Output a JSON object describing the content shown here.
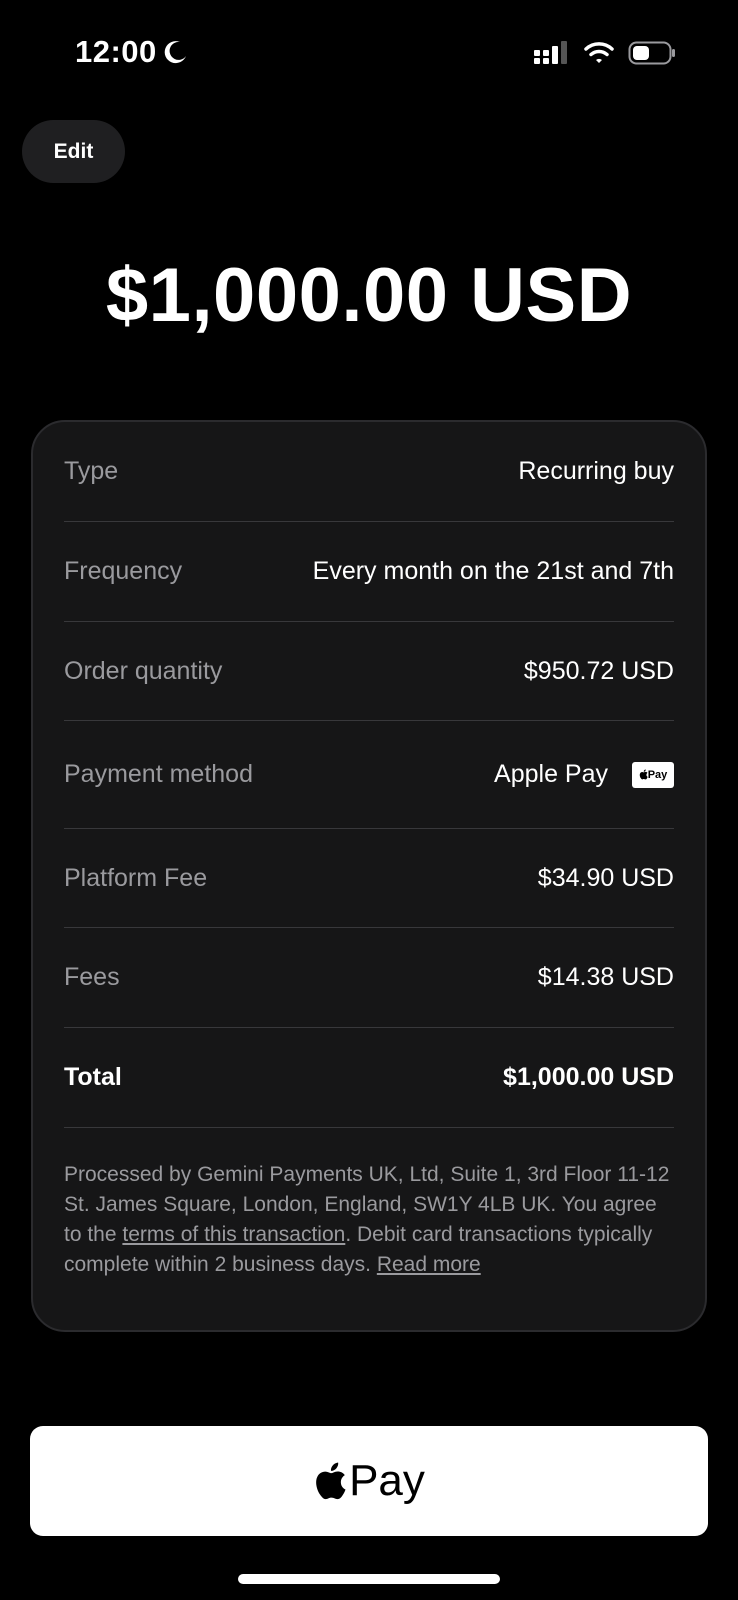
{
  "status_bar": {
    "time": "12:00",
    "icons": [
      "moon-icon",
      "cellular-signal-icon",
      "wifi-icon",
      "battery-icon"
    ]
  },
  "header": {
    "edit_label": "Edit"
  },
  "amount": "$1,000.00 USD",
  "summary": {
    "rows": [
      {
        "label": "Type",
        "value": "Recurring buy"
      },
      {
        "label": "Frequency",
        "value": "Every month on the 21st and 7th"
      },
      {
        "label": "Order quantity",
        "value": "$950.72 USD"
      },
      {
        "label": "Payment method",
        "value": "Apple Pay",
        "badge": "Pay"
      },
      {
        "label": "Platform Fee",
        "value": "$34.90 USD"
      },
      {
        "label": "Fees",
        "value": "$14.38 USD"
      },
      {
        "label": "Total",
        "value": "$1,000.00 USD"
      }
    ],
    "disclaimer": {
      "text_1": "Processed by Gemini Payments UK, Ltd, Suite 1, 3rd Floor 11-12 St. James Square, London, England, SW1Y 4LB UK. You agree to the ",
      "terms_link": "terms of this transaction",
      "text_2": ". Debit card transactions typically complete within 2 business days. ",
      "read_more": "Read more"
    }
  },
  "apple_pay_button": {
    "label": "Pay"
  },
  "colors": {
    "background": "#000000",
    "card": "#161617",
    "muted_text": "#9a9a9e",
    "button_bg": "#ffffff"
  }
}
